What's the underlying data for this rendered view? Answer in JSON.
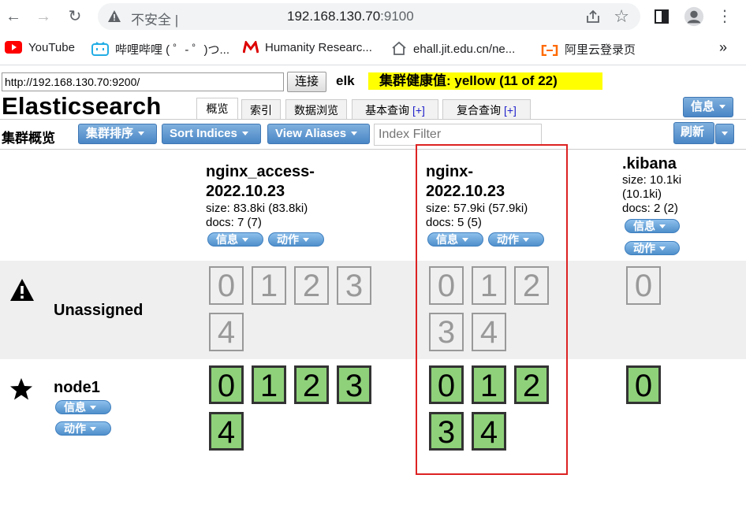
{
  "browser": {
    "address_insecure": "不安全",
    "address_host": "192.168.130.70",
    "address_port": ":9100",
    "bookmarks": [
      "YouTube",
      "哔哩哔哩 ( ゜- ゜)つ...",
      "Humanity Researc...",
      "ehall.jit.edu.cn/ne...",
      "阿里云登录页"
    ],
    "more": "»"
  },
  "app": {
    "connect_url": "http://192.168.130.70:9200/",
    "connect_label": "连接",
    "cluster_name": "elk",
    "health_text": "集群健康值: yellow (11 of 22)",
    "title": "Elasticsearch",
    "tabs": [
      {
        "label": "概览"
      },
      {
        "label": "索引"
      },
      {
        "label": "数据浏览"
      },
      {
        "label": "基本查询",
        "plus": "[+]"
      },
      {
        "label": "复合查询",
        "plus": "[+]"
      }
    ],
    "info_label": "信息",
    "toolbar": {
      "overview": "集群概览",
      "sort_cluster": "集群排序",
      "sort_indices": "Sort Indices",
      "view_aliases": "View Aliases",
      "filter_placeholder": "Index Filter",
      "refresh": "刷新"
    },
    "indices": [
      {
        "name_line1": "nginx_access-",
        "name_line2": "2022.10.23",
        "size": "size: 83.8ki (83.8ki)",
        "docs": "docs: 7 (7)"
      },
      {
        "name_line1": "nginx-",
        "name_line2": "2022.10.23",
        "size": "size: 57.9ki (57.9ki)",
        "docs": "docs: 5 (5)"
      },
      {
        "name_line1": ".kibana",
        "size_line1": "size: 10.1ki",
        "size_line2": "(10.1ki)",
        "docs": "docs: 2 (2)"
      }
    ],
    "pill_info": "信息",
    "pill_action": "动作",
    "rows": {
      "unassigned": "Unassigned",
      "node": "node1"
    },
    "shards": [
      "0",
      "1",
      "2",
      "3",
      "4"
    ],
    "kibana_shard": "0",
    "colors": {
      "health": "#ffff00",
      "shard_started": "#8fd17a",
      "button": "#4a86c6",
      "highlight": "#dd2222"
    }
  }
}
